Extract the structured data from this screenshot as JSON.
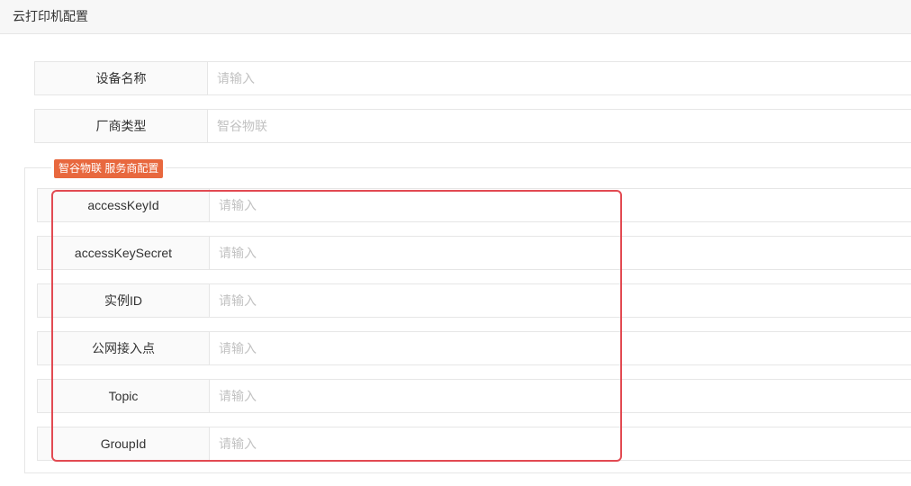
{
  "header": {
    "title": "云打印机配置"
  },
  "device_name": {
    "label": "设备名称",
    "placeholder": "请输入",
    "value": ""
  },
  "vendor_type": {
    "label": "厂商类型",
    "value": "智谷物联"
  },
  "provider_config": {
    "legend": "智谷物联 服务商配置",
    "fields": [
      {
        "label": "accessKeyId",
        "placeholder": "请输入",
        "value": ""
      },
      {
        "label": "accessKeySecret",
        "placeholder": "请输入",
        "value": ""
      },
      {
        "label": "实例ID",
        "placeholder": "请输入",
        "value": ""
      },
      {
        "label": "公网接入点",
        "placeholder": "请输入",
        "value": ""
      },
      {
        "label": "Topic",
        "placeholder": "请输入",
        "value": ""
      },
      {
        "label": "GroupId",
        "placeholder": "请输入",
        "value": ""
      }
    ]
  },
  "colors": {
    "legend_badge": "#e8683e",
    "highlight_border": "#e24a52",
    "border": "#e6e6e6",
    "label_bg": "#fafafa",
    "placeholder": "#c2c2c2"
  }
}
